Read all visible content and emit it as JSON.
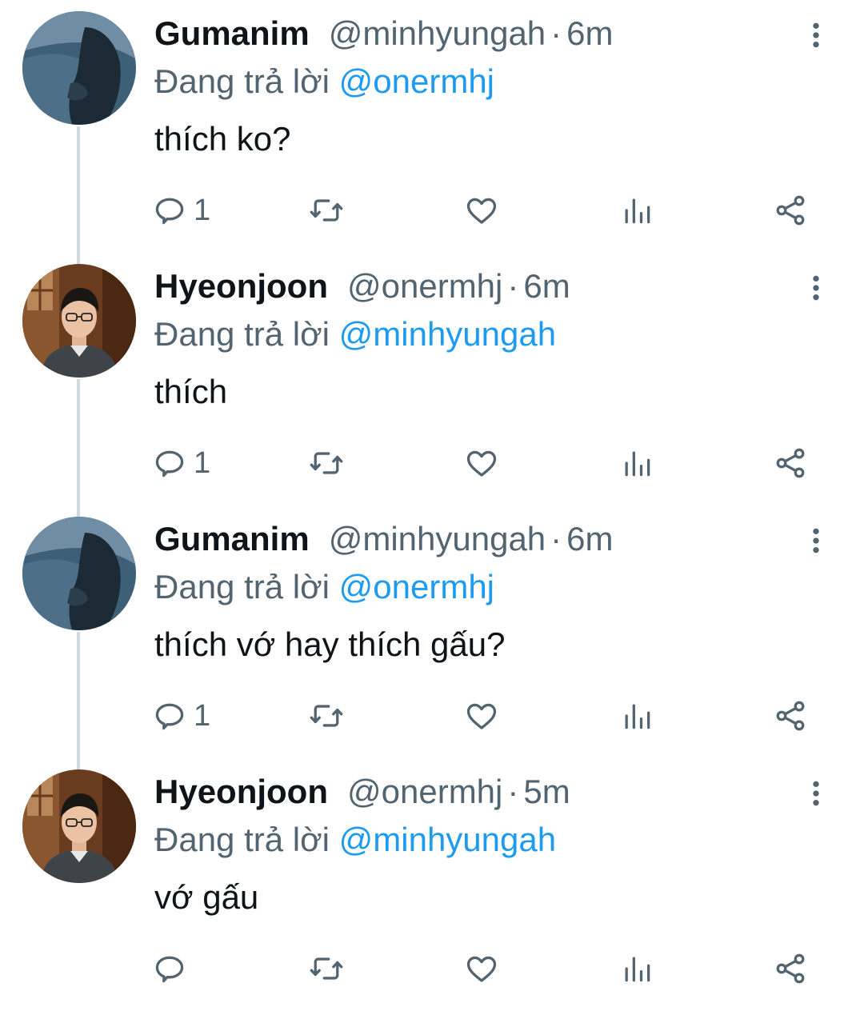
{
  "colors": {
    "accent": "#1d9bf0",
    "secondary_text": "#536471",
    "primary_text": "#0f1419",
    "thread_line": "#cfd9de"
  },
  "labels": {
    "replying_prefix": "Đang trả lời",
    "dot": "·"
  },
  "tweets": [
    {
      "name": "Gumanim",
      "handle": "@minhyungah",
      "time": "6m",
      "replying_to": "@onermhj",
      "text": "thích ko?",
      "reply_count": "1",
      "avatar_icon": "dark-blue-silhouette-avatar"
    },
    {
      "name": "Hyeonjoon",
      "handle": "@onermhj",
      "time": "6m",
      "replying_to": "@minhyungah",
      "text": "thích",
      "reply_count": "1",
      "avatar_icon": "person-with-glasses-avatar"
    },
    {
      "name": "Gumanim",
      "handle": "@minhyungah",
      "time": "6m",
      "replying_to": "@onermhj",
      "text": "thích vớ hay thích gấu?",
      "reply_count": "1",
      "avatar_icon": "dark-blue-silhouette-avatar"
    },
    {
      "name": "Hyeonjoon",
      "handle": "@onermhj",
      "time": "5m",
      "replying_to": "@minhyungah",
      "text": "vớ gấu",
      "reply_count": "",
      "avatar_icon": "person-with-glasses-avatar"
    }
  ]
}
